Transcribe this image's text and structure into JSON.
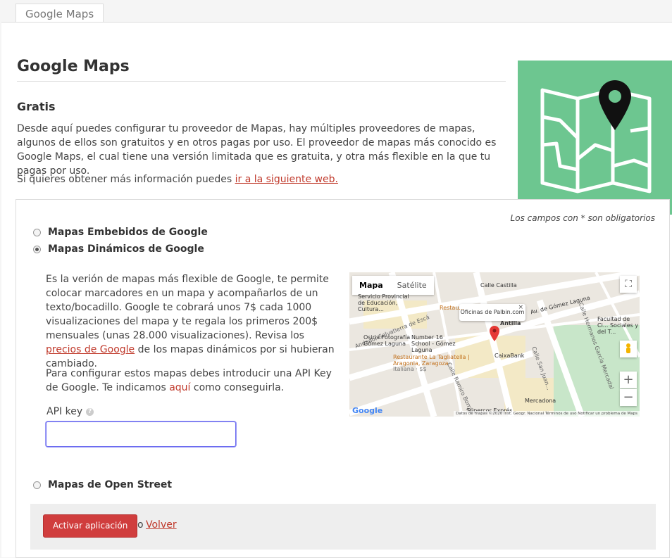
{
  "tab": {
    "label": "Google Maps"
  },
  "header": {
    "title": "Google Maps"
  },
  "intro": {
    "subtitle": "Gratis",
    "description": "Desde aquí puedes configurar tu proveedor de Mapas, hay múltiples proveedores de mapas, algunos de ellos son gratuitos y en otros pagas por uso. El proveedor de mapas más conocido es Google Maps, el cual tiene una versión limitada que es gratuita, y otra más flexible en la que tu pagas por uso.",
    "more_prefix": "Si quieres obtener más información puedes ",
    "more_link": "ir a la siguiente web."
  },
  "hero": {
    "icon": "map-pin-icon",
    "background": "#6dc690"
  },
  "form": {
    "required_note": "Los campos con * son obligatorios",
    "options": [
      {
        "label": "Mapas Embebidos de Google",
        "selected": false
      },
      {
        "label": "Mapas Dinámicos de Google",
        "selected": true
      },
      {
        "label": "Mapas de Open Street",
        "selected": false
      }
    ],
    "dynamic": {
      "text_before": "Es la verión de mapas más flexible de Google, te permite colocar marcadores en un mapa y acompañarlos de un texto/bocadillo. Google te cobrará unos 7$ cada 1000 visualizaciones del mapa y te regala los primeros 200$ mensuales (unas 28.000 visualizaciones). Revisa los ",
      "prices_link": "precios de Google",
      "text_after": " de los mapas dinámicos por si hubieran cambiado.",
      "config_before": "Para configurar estos mapas debes introducir una API Key de Google. Te indicamos ",
      "config_link": "aquí",
      "config_after": " como conseguirla.",
      "api_label": "API key",
      "api_value": ""
    },
    "map": {
      "tab_map": "Mapa",
      "tab_satellite": "Satélite",
      "info_window": "Oficinas de Palbin.com",
      "zoom_in": "+",
      "zoom_out": "−",
      "fullscreen": "⛶",
      "logo": "Google",
      "attribution": "Datos de mapas ©2020 Inst. Geogr. Nacional   Términos de uso   Notificar un problema de Maps",
      "labels": [
        "Calle Castilla",
        "Servicio Provincial de Educación, Cultura...",
        "Restau...",
        "Av. de Gómez Laguna",
        "Antilla",
        "Facultad de Ci... Sociales y del T...",
        "Andador Salvatierra de Escá",
        "Osiria Fotografía Gómez Laguna",
        "Number 16 School - Gómez Laguna",
        "CaixaBank",
        "Restaurante La Tagliatella | Aragonia, Zaragoza",
        "Italiana · $$",
        "Calle Hermanos García Mercadal",
        "Calle Ramiro Borrás",
        "Mercadona",
        "Supercor Exprés",
        "Calle San Juan..."
      ]
    },
    "actions": {
      "submit": "Activar aplicación",
      "or": "o",
      "back": "Volver"
    }
  }
}
